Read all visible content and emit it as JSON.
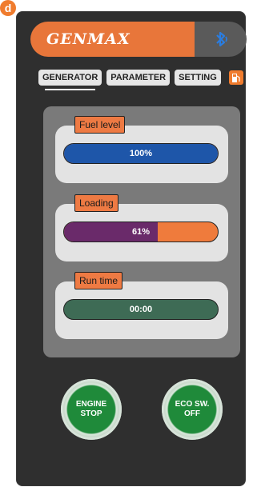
{
  "badge": "d",
  "header": {
    "brand": "GENMAX"
  },
  "tabs": [
    {
      "label": "GENERATOR",
      "active": true
    },
    {
      "label": "PARAMETER",
      "active": false
    },
    {
      "label": "SETTING",
      "active": false
    }
  ],
  "cards": {
    "fuel": {
      "label": "Fuel level",
      "value": "100%",
      "fraction": 1.0,
      "color": "#1e56a9"
    },
    "loading": {
      "label": "Loading",
      "value": "61%",
      "fraction": 0.61,
      "color": "#6a2a6a",
      "track": "#ef7b3c"
    },
    "runtime": {
      "label": "Run time",
      "value": "00:00",
      "color": "#3e6b55"
    }
  },
  "buttons": {
    "engine": {
      "line1": "ENGINE",
      "line2": "STOP"
    },
    "eco": {
      "line1": "ECO SW.",
      "line2": "OFF"
    }
  },
  "icons": [
    "bluetooth-icon",
    "fuel-pump-icon"
  ],
  "colors": {
    "accent": "#e8763a",
    "background": "#2f2f2f",
    "panel": "#7a7a7a"
  }
}
